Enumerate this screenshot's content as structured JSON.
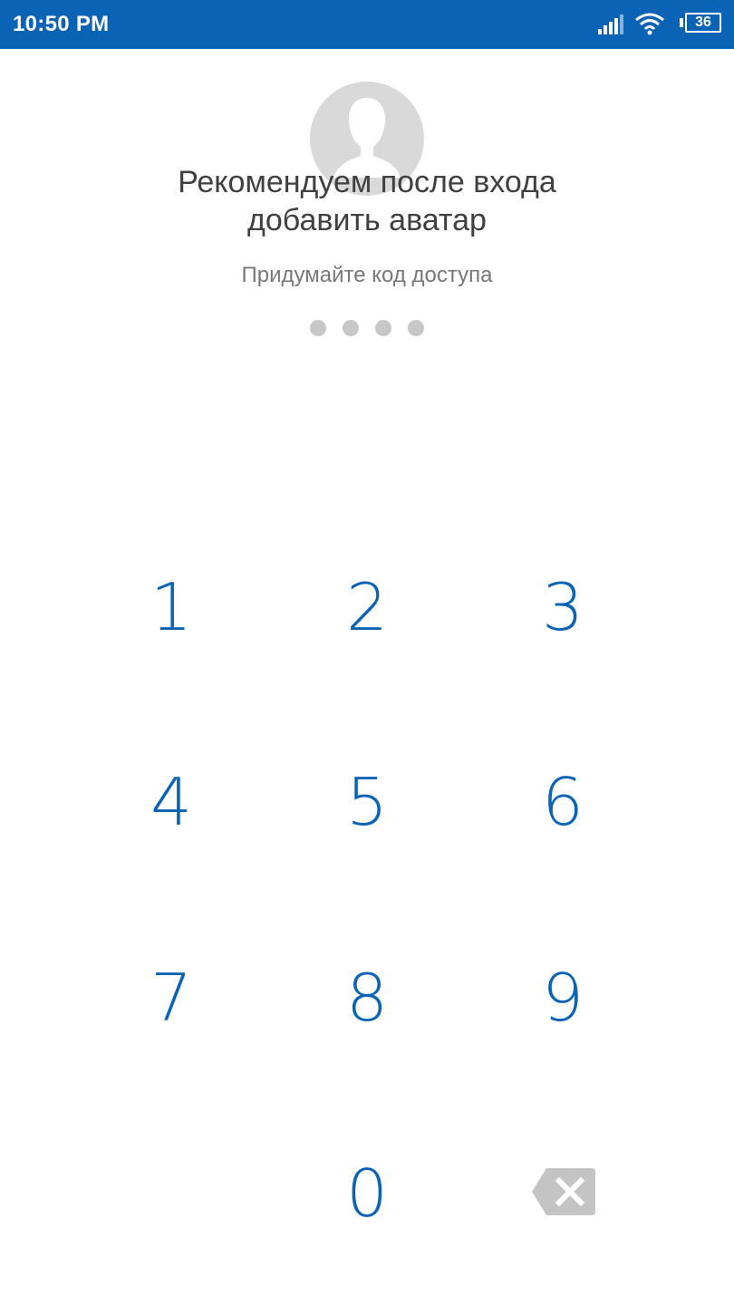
{
  "status_bar": {
    "time": "10:50 PM",
    "battery": "36",
    "icons": [
      "signal-icon",
      "wifi-icon",
      "battery-icon"
    ],
    "background": "#0b63b5"
  },
  "prompt": {
    "avatar_icon": "user-silhouette-icon",
    "title_line1": "Рекомендуем после входа",
    "title_line2": "добавить аватар",
    "subtitle": "Придумайте код доступа"
  },
  "passcode": {
    "length": 4,
    "filled": 0
  },
  "keypad": {
    "keys": [
      "1",
      "2",
      "3",
      "4",
      "5",
      "6",
      "7",
      "8",
      "9",
      "0"
    ],
    "backspace_icon": "backspace-icon",
    "accent": "#0b63b5"
  }
}
